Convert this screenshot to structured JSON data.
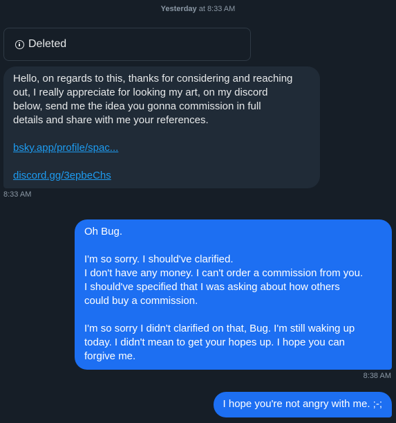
{
  "day_separator": {
    "day": "Yesterday",
    "time": " at 8:33 AM"
  },
  "deleted_card": {
    "icon": "info-icon",
    "label": "Deleted"
  },
  "incoming_message": {
    "paragraph_lines": [
      "Hello, on regards to this, thanks for considering and reaching",
      "out, I really appreciate for looking my art, on my discord",
      "below, send me the idea you gonna commission in full",
      "details and share with me your references."
    ],
    "link_1": "bsky.app/profile/spac...",
    "link_2": "discord.gg/3epbeChs",
    "timestamp": "8:33 AM"
  },
  "outgoing_message_1": {
    "line_1": "Oh Bug.",
    "para_2_lines": [
      "I'm so sorry. I should've clarified.",
      "I don't have any money. I can't order a commission from you.",
      "I should've specified that I was asking about how others",
      "could buy a commission."
    ],
    "para_3_lines": [
      "I'm so sorry I didn't clarified on that, Bug. I'm still waking up",
      "today. I didn't mean to get your hopes up. I hope you can",
      "forgive me."
    ],
    "timestamp": "8:38 AM"
  },
  "outgoing_message_2": {
    "text": "I hope you're not angry with me. ;-;"
  },
  "colors": {
    "background": "#161e27",
    "incoming_bubble": "#202b37",
    "outgoing_bubble": "#1d6ff2",
    "link": "#1d9bf0",
    "muted_text": "#8b98a5"
  }
}
